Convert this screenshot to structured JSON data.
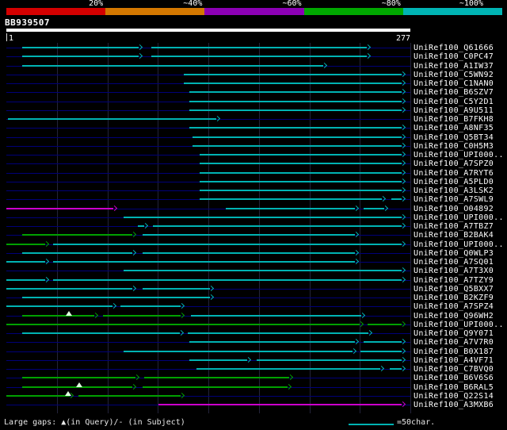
{
  "chart_data": {
    "type": "bar",
    "subtype": "blast-alignment-overview",
    "title": "BB939507",
    "x_axis": {
      "start_label": "1",
      "end_label": "277",
      "min": 1,
      "max": 277
    },
    "identity_scale": [
      {
        "label": "20%",
        "color": "#d40000"
      },
      {
        "label": "~40%",
        "color": "#d47800"
      },
      {
        "label": "~60%",
        "color": "#8c00b4"
      },
      {
        "label": "~80%",
        "color": "#00a800"
      },
      {
        "label": "~100%",
        "color": "#00b4b4"
      }
    ],
    "colors": {
      "cyan": "#00b3b3",
      "green": "#00a000",
      "magenta": "#cc00cc",
      "gap_marker": "#e0ffe0"
    },
    "rows": [
      {
        "label": "UniRef100_Q61666",
        "segments": [
          {
            "from": 12,
            "to": 94,
            "color": "cyan"
          },
          {
            "from": 100,
            "to": 250,
            "color": "cyan"
          }
        ]
      },
      {
        "label": "UniRef100_C0PC47",
        "segments": [
          {
            "from": 12,
            "to": 94,
            "color": "cyan"
          },
          {
            "from": 100,
            "to": 250,
            "color": "cyan"
          }
        ]
      },
      {
        "label": "UniRef100_A1IW37",
        "segments": [
          {
            "from": 12,
            "to": 220,
            "color": "cyan"
          }
        ]
      },
      {
        "label": "UniRef100_C5WN92",
        "segments": [
          {
            "from": 122,
            "to": 274,
            "color": "cyan"
          }
        ]
      },
      {
        "label": "UniRef100_C1NAN0",
        "segments": [
          {
            "from": 122,
            "to": 274,
            "color": "cyan"
          }
        ]
      },
      {
        "label": "UniRef100_B6SZV7",
        "segments": [
          {
            "from": 126,
            "to": 274,
            "color": "cyan"
          }
        ]
      },
      {
        "label": "UniRef100_C5Y2D1",
        "segments": [
          {
            "from": 126,
            "to": 274,
            "color": "cyan"
          }
        ]
      },
      {
        "label": "UniRef100_A9U511",
        "segments": [
          {
            "from": 126,
            "to": 274,
            "color": "cyan"
          }
        ]
      },
      {
        "label": "UniRef100_B7FKH8",
        "segments": [
          {
            "from": 2,
            "to": 147,
            "color": "cyan"
          }
        ]
      },
      {
        "label": "UniRef100_A8NF35",
        "segments": [
          {
            "from": 126,
            "to": 274,
            "color": "cyan"
          }
        ]
      },
      {
        "label": "UniRef100_Q5BT34",
        "segments": [
          {
            "from": 128,
            "to": 274,
            "color": "cyan"
          }
        ]
      },
      {
        "label": "UniRef100_C0H5M3",
        "segments": [
          {
            "from": 128,
            "to": 274,
            "color": "cyan"
          }
        ]
      },
      {
        "label": "UniRef100_UPI000..",
        "segments": [
          {
            "from": 133,
            "to": 274,
            "color": "cyan"
          }
        ]
      },
      {
        "label": "UniRef100_A7SPZ0",
        "segments": [
          {
            "from": 133,
            "to": 274,
            "color": "cyan"
          }
        ]
      },
      {
        "label": "UniRef100_A7RYT6",
        "segments": [
          {
            "from": 133,
            "to": 274,
            "color": "cyan"
          }
        ]
      },
      {
        "label": "UniRef100_A5PLD0",
        "segments": [
          {
            "from": 133,
            "to": 274,
            "color": "cyan"
          }
        ]
      },
      {
        "label": "UniRef100_A3LSK2",
        "segments": [
          {
            "from": 133,
            "to": 274,
            "color": "cyan"
          }
        ]
      },
      {
        "label": "UniRef100_A7SWL9",
        "segments": [
          {
            "from": 133,
            "to": 260,
            "color": "cyan"
          },
          {
            "from": 264,
            "to": 274,
            "color": "cyan"
          }
        ]
      },
      {
        "label": "UniRef100_O04892",
        "segments": [
          {
            "from": 1,
            "to": 77,
            "color": "magenta"
          },
          {
            "from": 151,
            "to": 242,
            "color": "cyan"
          },
          {
            "from": 245,
            "to": 262,
            "color": "cyan"
          }
        ]
      },
      {
        "label": "UniRef100_UPI000..",
        "segments": [
          {
            "from": 81,
            "to": 274,
            "color": "cyan"
          }
        ]
      },
      {
        "label": "UniRef100_A7TBZ7",
        "segments": [
          {
            "from": 91,
            "to": 98,
            "color": "cyan"
          },
          {
            "from": 101,
            "to": 274,
            "color": "cyan"
          }
        ]
      },
      {
        "label": "UniRef100_B2BAK4",
        "segments": [
          {
            "from": 12,
            "to": 90,
            "color": "green"
          },
          {
            "from": 94,
            "to": 242,
            "color": "cyan"
          }
        ]
      },
      {
        "label": "UniRef100_UPI000..",
        "segments": [
          {
            "from": 1,
            "to": 30,
            "color": "green"
          },
          {
            "from": 33,
            "to": 274,
            "color": "cyan"
          }
        ]
      },
      {
        "label": "UniRef100_Q0WLP3",
        "segments": [
          {
            "from": 12,
            "to": 90,
            "color": "cyan"
          },
          {
            "from": 94,
            "to": 242,
            "color": "cyan"
          }
        ]
      },
      {
        "label": "UniRef100_A7SQ01",
        "segments": [
          {
            "from": 1,
            "to": 30,
            "color": "cyan"
          },
          {
            "from": 33,
            "to": 242,
            "color": "cyan"
          }
        ]
      },
      {
        "label": "UniRef100_A7T3X0",
        "segments": [
          {
            "from": 81,
            "to": 274,
            "color": "cyan"
          }
        ]
      },
      {
        "label": "UniRef100_A7TZY9",
        "segments": [
          {
            "from": 1,
            "to": 30,
            "color": "cyan"
          },
          {
            "from": 33,
            "to": 274,
            "color": "cyan"
          }
        ]
      },
      {
        "label": "UniRef100_Q5BXX7",
        "segments": [
          {
            "from": 1,
            "to": 90,
            "color": "cyan"
          },
          {
            "from": 94,
            "to": 143,
            "color": "cyan"
          }
        ]
      },
      {
        "label": "UniRef100_B2KZF9",
        "segments": [
          {
            "from": 12,
            "to": 143,
            "color": "cyan"
          }
        ]
      },
      {
        "label": "UniRef100_A7SPZ4",
        "segments": [
          {
            "from": 1,
            "to": 76,
            "color": "cyan"
          },
          {
            "from": 79,
            "to": 123,
            "color": "cyan"
          }
        ]
      },
      {
        "label": "UniRef100_Q96WH2",
        "segments": [
          {
            "from": 12,
            "to": 64,
            "color": "green"
          },
          {
            "from": 67,
            "to": 123,
            "color": "green"
          },
          {
            "from": 127,
            "to": 246,
            "color": "cyan"
          }
        ],
        "markers": [
          {
            "at": 44
          }
        ]
      },
      {
        "label": "UniRef100_UPI000..",
        "segments": [
          {
            "from": 1,
            "to": 245,
            "color": "green"
          },
          {
            "from": 248,
            "to": 274,
            "color": "green"
          }
        ]
      },
      {
        "label": "UniRef100_Q9Y071",
        "segments": [
          {
            "from": 12,
            "to": 122,
            "color": "cyan"
          },
          {
            "from": 125,
            "to": 251,
            "color": "cyan"
          }
        ]
      },
      {
        "label": "UniRef100_A7V7R0",
        "segments": [
          {
            "from": 126,
            "to": 242,
            "color": "cyan"
          },
          {
            "from": 245,
            "to": 274,
            "color": "cyan"
          }
        ]
      },
      {
        "label": "UniRef100_B0X187",
        "segments": [
          {
            "from": 81,
            "to": 240,
            "color": "cyan"
          },
          {
            "from": 243,
            "to": 274,
            "color": "cyan"
          }
        ]
      },
      {
        "label": "UniRef100_A4VF71",
        "segments": [
          {
            "from": 126,
            "to": 168,
            "color": "cyan"
          },
          {
            "from": 172,
            "to": 274,
            "color": "cyan"
          }
        ]
      },
      {
        "label": "UniRef100_C7BVQ0",
        "segments": [
          {
            "from": 131,
            "to": 259,
            "color": "cyan"
          },
          {
            "from": 263,
            "to": 274,
            "color": "cyan"
          }
        ]
      },
      {
        "label": "UniRef100_B6V6S6",
        "segments": [
          {
            "from": 12,
            "to": 92,
            "color": "green"
          },
          {
            "from": 95,
            "to": 197,
            "color": "green"
          }
        ]
      },
      {
        "label": "UniRef100_B6RAL5",
        "segments": [
          {
            "from": 12,
            "to": 90,
            "color": "green"
          },
          {
            "from": 94,
            "to": 196,
            "color": "green"
          }
        ],
        "markers": [
          {
            "at": 51
          }
        ]
      },
      {
        "label": "UniRef100_Q22S14",
        "segments": [
          {
            "from": 1,
            "to": 47,
            "color": "green"
          },
          {
            "from": 50,
            "to": 123,
            "color": "green"
          }
        ],
        "markers": [
          {
            "at": 43
          }
        ]
      },
      {
        "label": "UniRef100_A3MXB6",
        "segments": [
          {
            "from": 105,
            "to": 274,
            "color": "magenta"
          }
        ]
      }
    ]
  },
  "legend": {
    "gaps_text": "Large gaps: ▲(in Query)/- (in Subject)",
    "scalebar_text": "=50char."
  }
}
